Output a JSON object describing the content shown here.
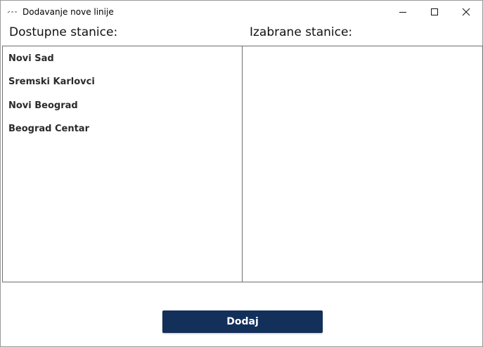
{
  "window": {
    "title": "Dodavanje nove linije",
    "app_icon": "app-icon",
    "controls": {
      "minimize_icon": "minimize-icon",
      "maximize_icon": "maximize-icon",
      "close_icon": "close-icon"
    }
  },
  "available": {
    "header": "Dostupne stanice:",
    "items": [
      "Novi Sad",
      "Sremski Karlovci",
      "Novi Beograd",
      "Beograd Centar"
    ]
  },
  "selected": {
    "header": "Izabrane stanice:",
    "items": []
  },
  "actions": {
    "add_label": "Dodaj",
    "add_color": "#12305a"
  }
}
